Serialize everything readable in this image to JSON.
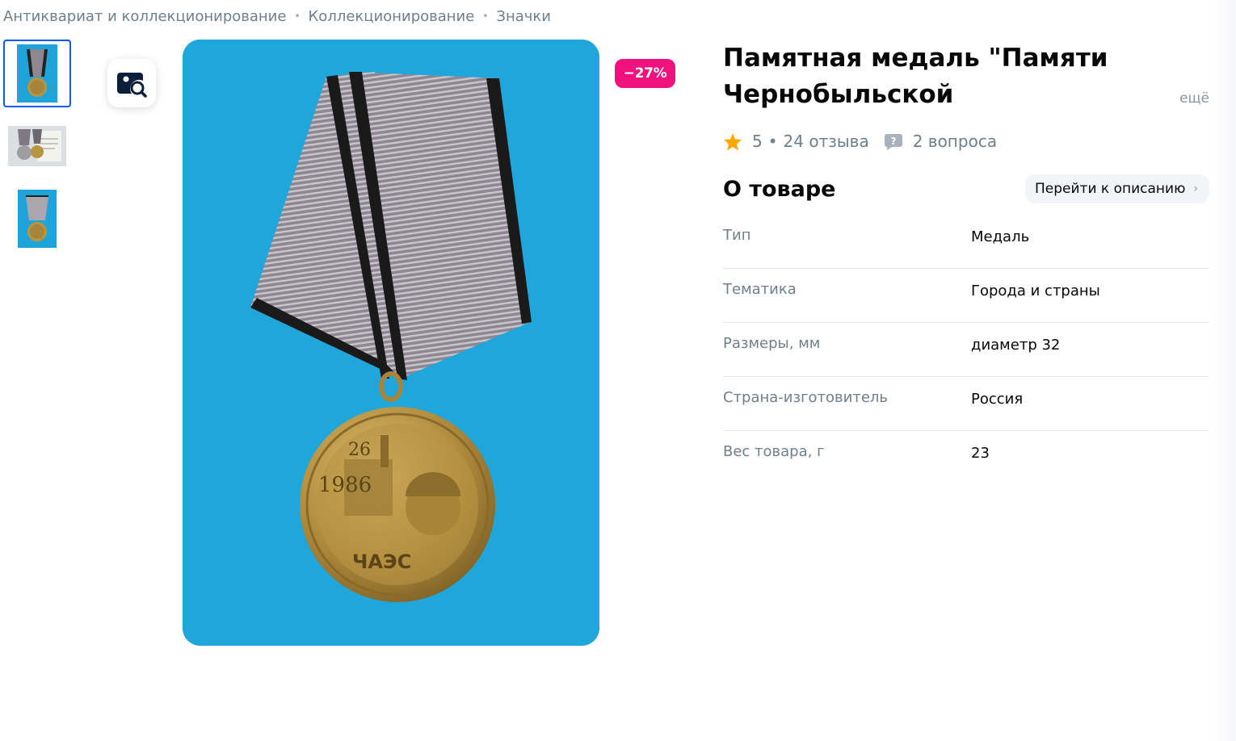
{
  "breadcrumb": {
    "items": [
      "Антиквариат и коллекционирование",
      "Коллекционирование",
      "Значки"
    ],
    "separator": "•"
  },
  "gallery": {
    "thumbnail_count": 3,
    "active_thumbnail": 1,
    "search_icon": "image-search-icon",
    "discount_badge": "−27%"
  },
  "product": {
    "title": "Памятная медаль \"Памяти Чернобыльской катастрофы...",
    "title_more": "ещё",
    "rating": "5",
    "rating_separator": "•",
    "reviews": "24 отзыва",
    "questions": "2 вопроса"
  },
  "about": {
    "title": "О товаре",
    "goto_label": "Перейти к описанию",
    "specs": [
      {
        "label": "Тип",
        "value": "Медаль"
      },
      {
        "label": "Тематика",
        "value": "Города и страны"
      },
      {
        "label": "Размеры, мм",
        "value": "диаметр 32"
      },
      {
        "label": "Страна-изготовитель",
        "value": "Россия"
      },
      {
        "label": "Вес товара, г",
        "value": "23"
      }
    ]
  },
  "colors": {
    "accent": "#005bff",
    "discount": "#f1117e",
    "star": "#ffa800",
    "photo_background": "#1fa4d9"
  }
}
